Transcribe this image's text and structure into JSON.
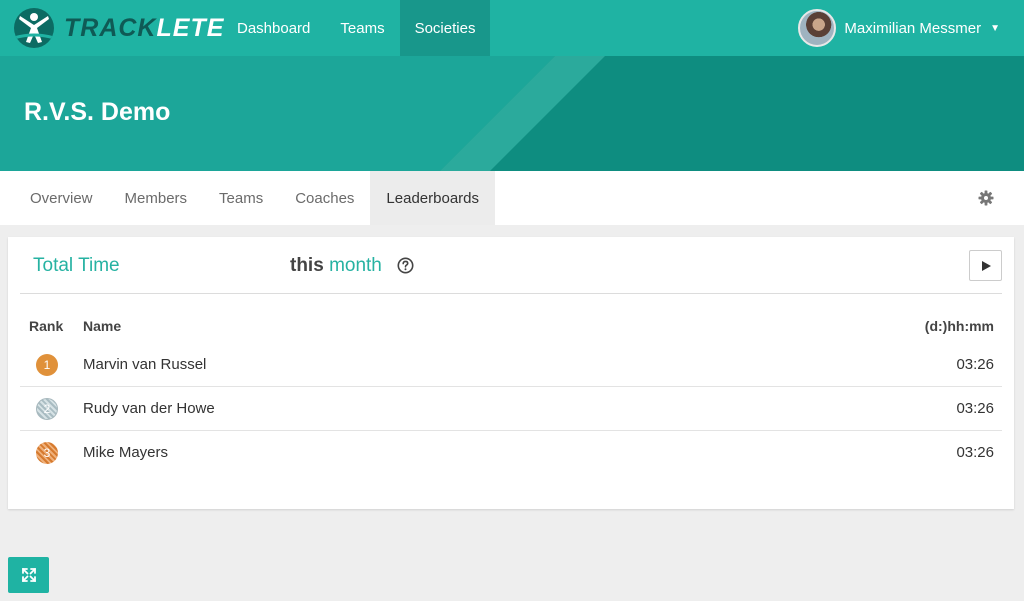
{
  "app": {
    "logo_part1": "TRACK",
    "logo_part2": "LETE"
  },
  "nav": {
    "items": [
      {
        "label": "Dashboard"
      },
      {
        "label": "Teams"
      },
      {
        "label": "Societies"
      }
    ],
    "active_index": 2
  },
  "user": {
    "name": "Maximilian Messmer"
  },
  "banner": {
    "title": "R.V.S. Demo"
  },
  "subnav": {
    "tabs": [
      {
        "label": "Overview"
      },
      {
        "label": "Members"
      },
      {
        "label": "Teams"
      },
      {
        "label": "Coaches"
      },
      {
        "label": "Leaderboards"
      }
    ],
    "active_index": 4
  },
  "leaderboard": {
    "metric": "Total Time",
    "period_prefix": "this",
    "period": "month",
    "columns": {
      "rank": "Rank",
      "name": "Name",
      "value": "(d:)hh:mm"
    },
    "rows": [
      {
        "rank": "1",
        "name": "Marvin van Russel",
        "value": "03:26",
        "medal": "gold"
      },
      {
        "rank": "2",
        "name": "Rudy van der Howe",
        "value": "03:26",
        "medal": "silver"
      },
      {
        "rank": "3",
        "name": "Mike Mayers",
        "value": "03:26",
        "medal": "bronze"
      }
    ]
  },
  "colors": {
    "primary": "#1fb3a3",
    "banner": "#1ca699",
    "banner_dark": "#0e8d80",
    "accent_text": "#26b2a2"
  },
  "icons": {
    "settings": "gear-icon",
    "help": "question-circle-icon",
    "play": "play-icon",
    "fullscreen": "expand-icon",
    "caret": "caret-down-icon"
  }
}
